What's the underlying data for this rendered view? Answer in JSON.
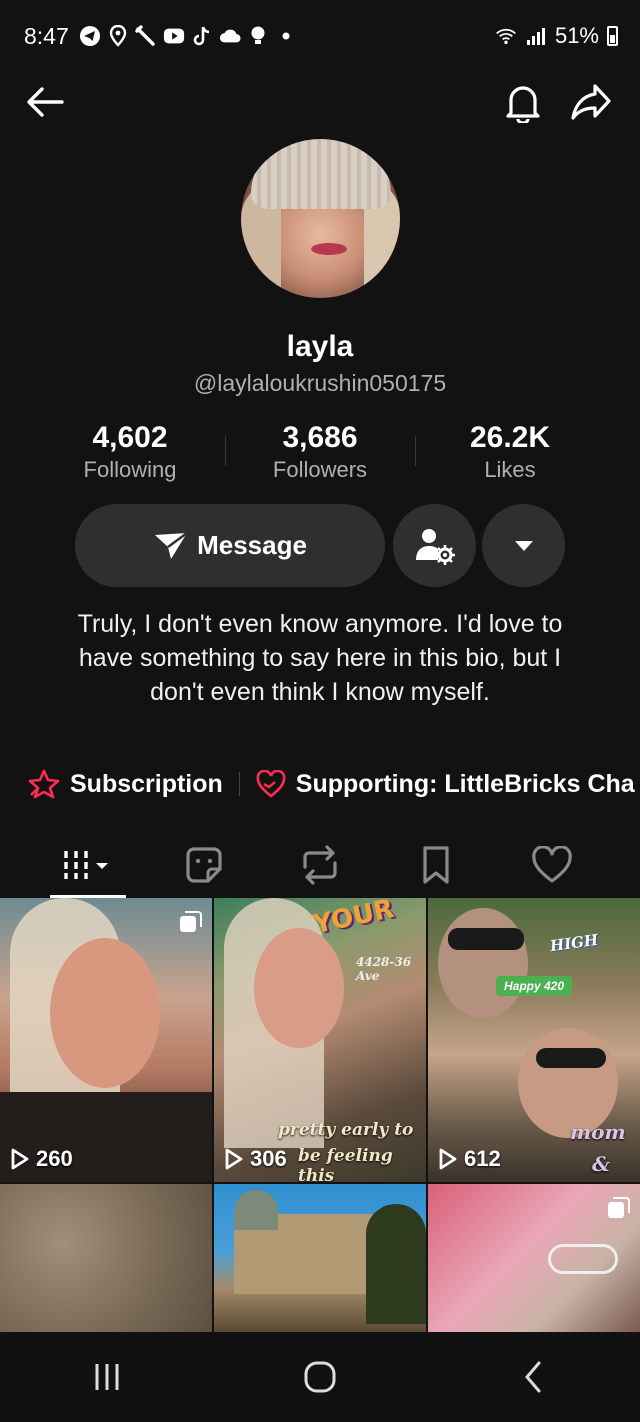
{
  "status_bar": {
    "time": "8:47",
    "icons": [
      "telegram-icon",
      "location-icon",
      "tools-icon",
      "youtube-icon",
      "tiktok-icon",
      "cloud-icon",
      "bulb-icon",
      "dot-icon"
    ],
    "battery": "51%"
  },
  "nav": {
    "back_icon": "arrow-left-icon",
    "bell_icon": "bell-icon",
    "share_icon": "share-icon"
  },
  "profile": {
    "name": "layla",
    "handle": "@laylaloukrushin050175",
    "stats": [
      {
        "value": "4,602",
        "label": "Following"
      },
      {
        "value": "3,686",
        "label": "Followers"
      },
      {
        "value": "26.2K",
        "label": "Likes"
      }
    ],
    "message_label": "Message",
    "bio": "Truly, I don't even know anymore. I'd love to have something to say here in this bio, but I don't even think I know myself.",
    "subscription_label": "Subscription",
    "supporting_label": "Supporting: LittleBricks Cha"
  },
  "tabs": [
    "videos-tab",
    "stickers-tab",
    "reposts-tab",
    "saved-tab",
    "liked-tab"
  ],
  "grid": {
    "items": [
      {
        "views": "260"
      },
      {
        "views": "306",
        "caption_1": "pretty early to",
        "caption_2": "be feeling this",
        "tag": "4428-36 Ave",
        "sign": "YOUR"
      },
      {
        "views": "612",
        "tag": "Happy 420",
        "caption": "mom",
        "caption_amp": "&",
        "sign": "HIGH"
      }
    ]
  },
  "colors": {
    "background": "#121212",
    "button_bg": "#2f2f2f",
    "accent_red": "#fe2c55",
    "muted_text": "#b0b0b0"
  }
}
